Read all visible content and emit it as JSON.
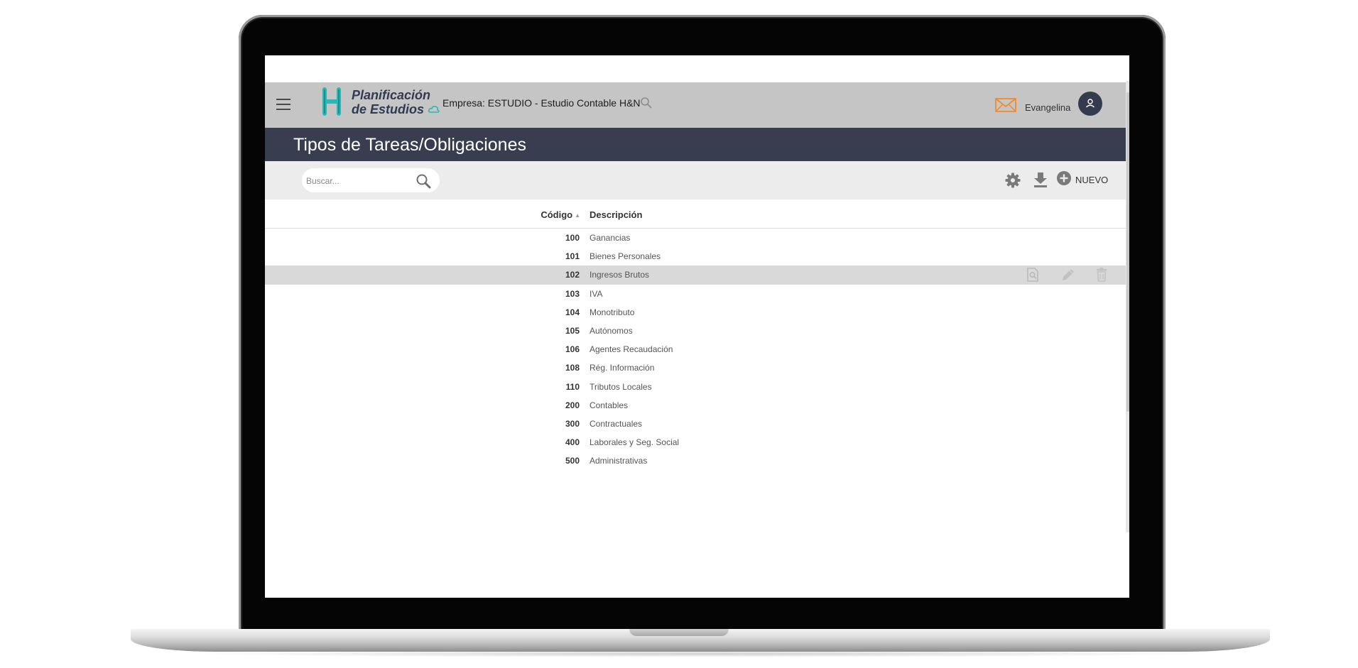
{
  "header": {
    "logo_line1": "Planificación",
    "logo_line2": "de Estudios",
    "company": "Empresa: ESTUDIO - Estudio Contable H&N",
    "username": "Evangelina"
  },
  "page": {
    "title": "Tipos de Tareas/Obligaciones"
  },
  "toolbar": {
    "search_placeholder": "Buscar...",
    "search_value": "",
    "new_label": "NUEVO"
  },
  "table": {
    "columns": {
      "code": "Código",
      "description": "Descripción"
    },
    "sort_indicator": "▲",
    "rows": [
      {
        "code": "100",
        "description": "Ganancias"
      },
      {
        "code": "101",
        "description": "Bienes Personales"
      },
      {
        "code": "102",
        "description": "Ingresos Brutos"
      },
      {
        "code": "103",
        "description": "IVA"
      },
      {
        "code": "104",
        "description": "Monotributo"
      },
      {
        "code": "105",
        "description": "Autónomos"
      },
      {
        "code": "106",
        "description": "Agentes Recaudación"
      },
      {
        "code": "108",
        "description": "Rég. Información"
      },
      {
        "code": "110",
        "description": "Tributos Locales"
      },
      {
        "code": "200",
        "description": "Contables"
      },
      {
        "code": "300",
        "description": "Contractuales"
      },
      {
        "code": "400",
        "description": "Laborales y Seg. Social"
      },
      {
        "code": "500",
        "description": "Administrativas"
      }
    ],
    "hovered_row_index": 2,
    "row_action_icons": [
      "view-icon",
      "edit-icon",
      "delete-icon"
    ]
  },
  "colors": {
    "topbar": "#c5c5c5",
    "titlebar": "#383e50",
    "accent_teal": "#2bb7b5",
    "mail_orange": "#f08a2c"
  }
}
